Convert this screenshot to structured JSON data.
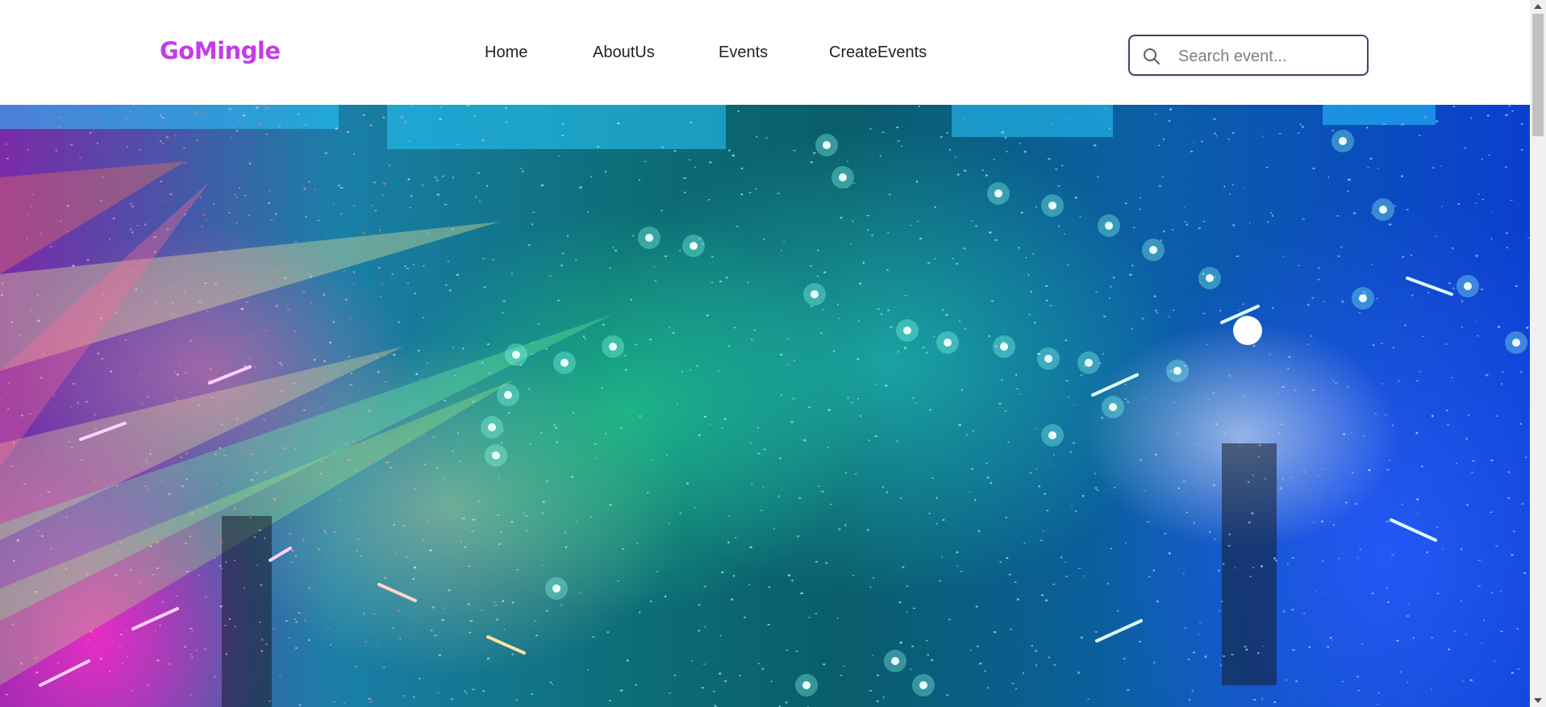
{
  "brand": {
    "name": "GoMingle",
    "color": "#c53be8"
  },
  "nav": {
    "items": [
      {
        "label": "Home"
      },
      {
        "label": "AboutUs"
      },
      {
        "label": "Events"
      },
      {
        "label": "CreateEvents"
      }
    ]
  },
  "search": {
    "placeholder": "Search event...",
    "value": "",
    "icon": "search-icon",
    "border_color": "#3b4a63"
  },
  "hero": {
    "image": "concert stage with colorful lights and confetti",
    "colors": [
      "#ff28c8",
      "#28e68c",
      "#28dcc8",
      "#285aff"
    ]
  }
}
